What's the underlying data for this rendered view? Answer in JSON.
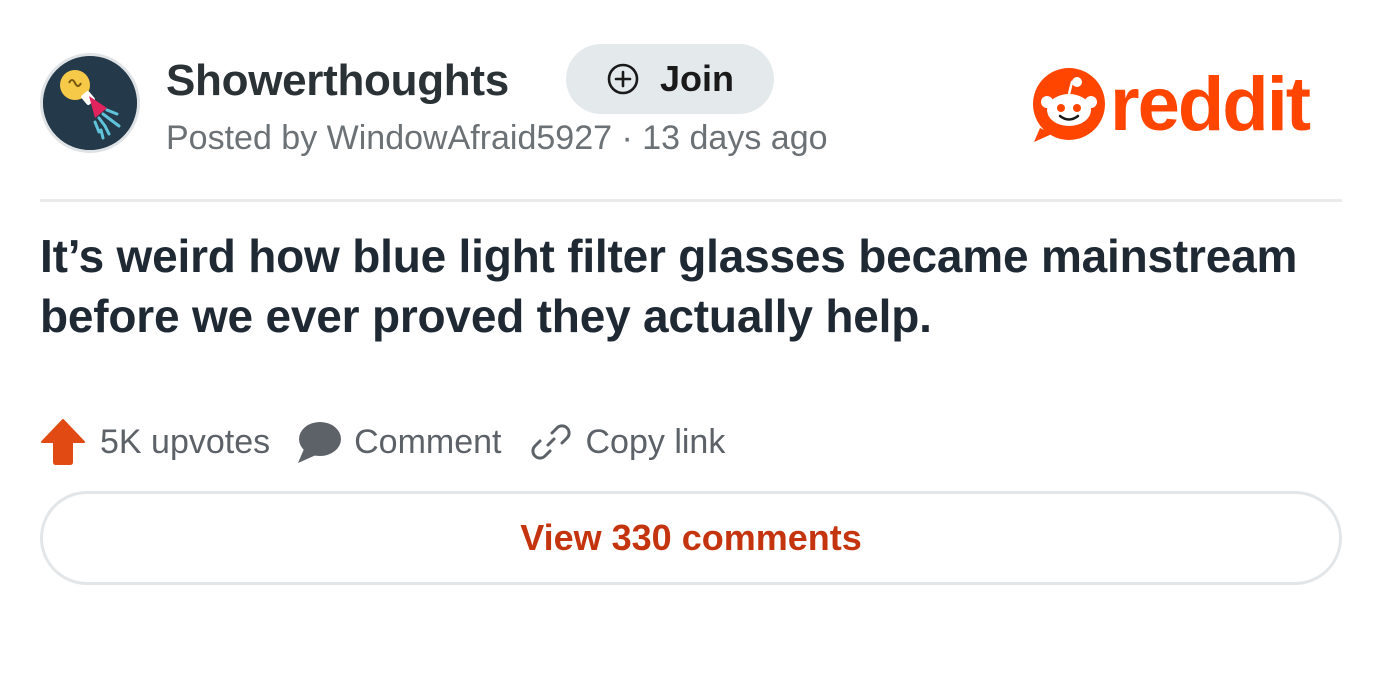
{
  "post": {
    "subreddit": "Showerthoughts",
    "join_label": "Join",
    "meta": "Posted by WindowAfraid5927 · 13 days ago",
    "title": "It’s weird how blue light filter glasses became mainstream before we ever proved they actually help.",
    "upvotes_label": "5K upvotes",
    "comment_label": "Comment",
    "copy_link_label": "Copy link",
    "view_comments_label": "View 330 comments"
  },
  "brand": {
    "wordmark": "reddit",
    "accent_color": "#ff4500",
    "link_color": "#c4340e"
  },
  "icons": {
    "avatar": "lightbulb-shower-icon",
    "join": "plus-circle-icon",
    "logo": "snoo-icon",
    "upvote": "upvote-arrow-icon",
    "comment": "speech-bubble-icon",
    "copy": "link-chain-icon"
  }
}
